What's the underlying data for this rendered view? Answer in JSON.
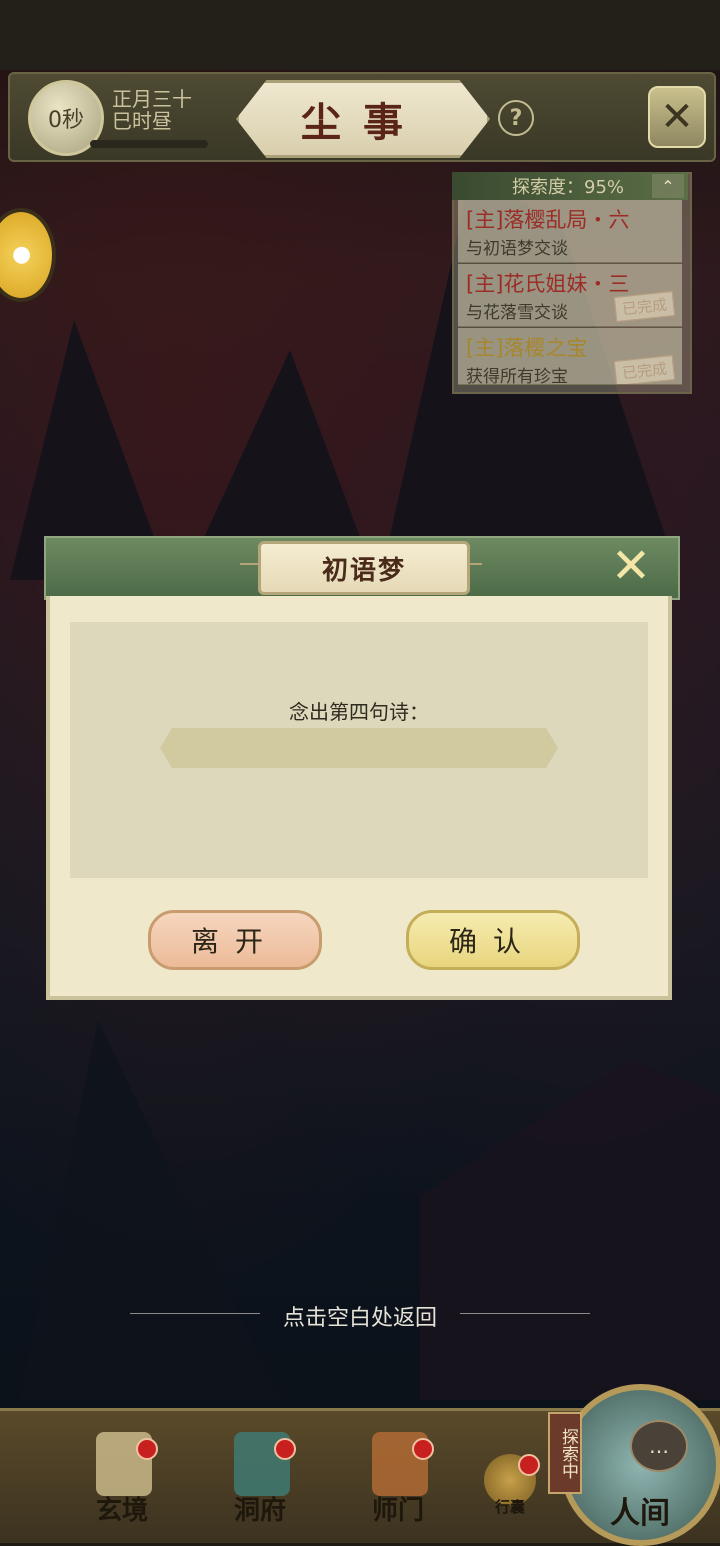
{
  "header": {
    "timer": "0秒",
    "date_line1": "正月三十",
    "date_line2": "巳时昼",
    "title": "尘事",
    "help": "?",
    "close": "✕"
  },
  "quest_panel": {
    "progress_label": "探索度：95%",
    "toggle": "⌃",
    "items": [
      {
        "title": "[主]落樱乱局・六",
        "desc": "与初语梦交谈",
        "stamp": ""
      },
      {
        "title": "[主]花氏姐妹・三",
        "desc": "与花落雪交谈",
        "stamp": "已完成"
      },
      {
        "title": "[主]落樱之宝",
        "desc": "获得所有珍宝",
        "stamp": "已完成"
      }
    ]
  },
  "dialog": {
    "title": "初语梦",
    "close": "✕",
    "prompt": "念出第四句诗：",
    "answer_value": "",
    "leave_label": "离开",
    "confirm_label": "确认"
  },
  "hint": "点击空白处返回",
  "bottom_nav": {
    "items": [
      "玄境",
      "洞府",
      "师门"
    ],
    "bag_label": "行囊",
    "world_label": "人间",
    "explore_tag": "探索中"
  },
  "colors": {
    "quest_main": "#9c2c26",
    "quest_done": "#a8862a",
    "dialog_header": "#5b7a52",
    "leave_button": "#ecbb98",
    "confirm_button": "#e8d57d"
  }
}
